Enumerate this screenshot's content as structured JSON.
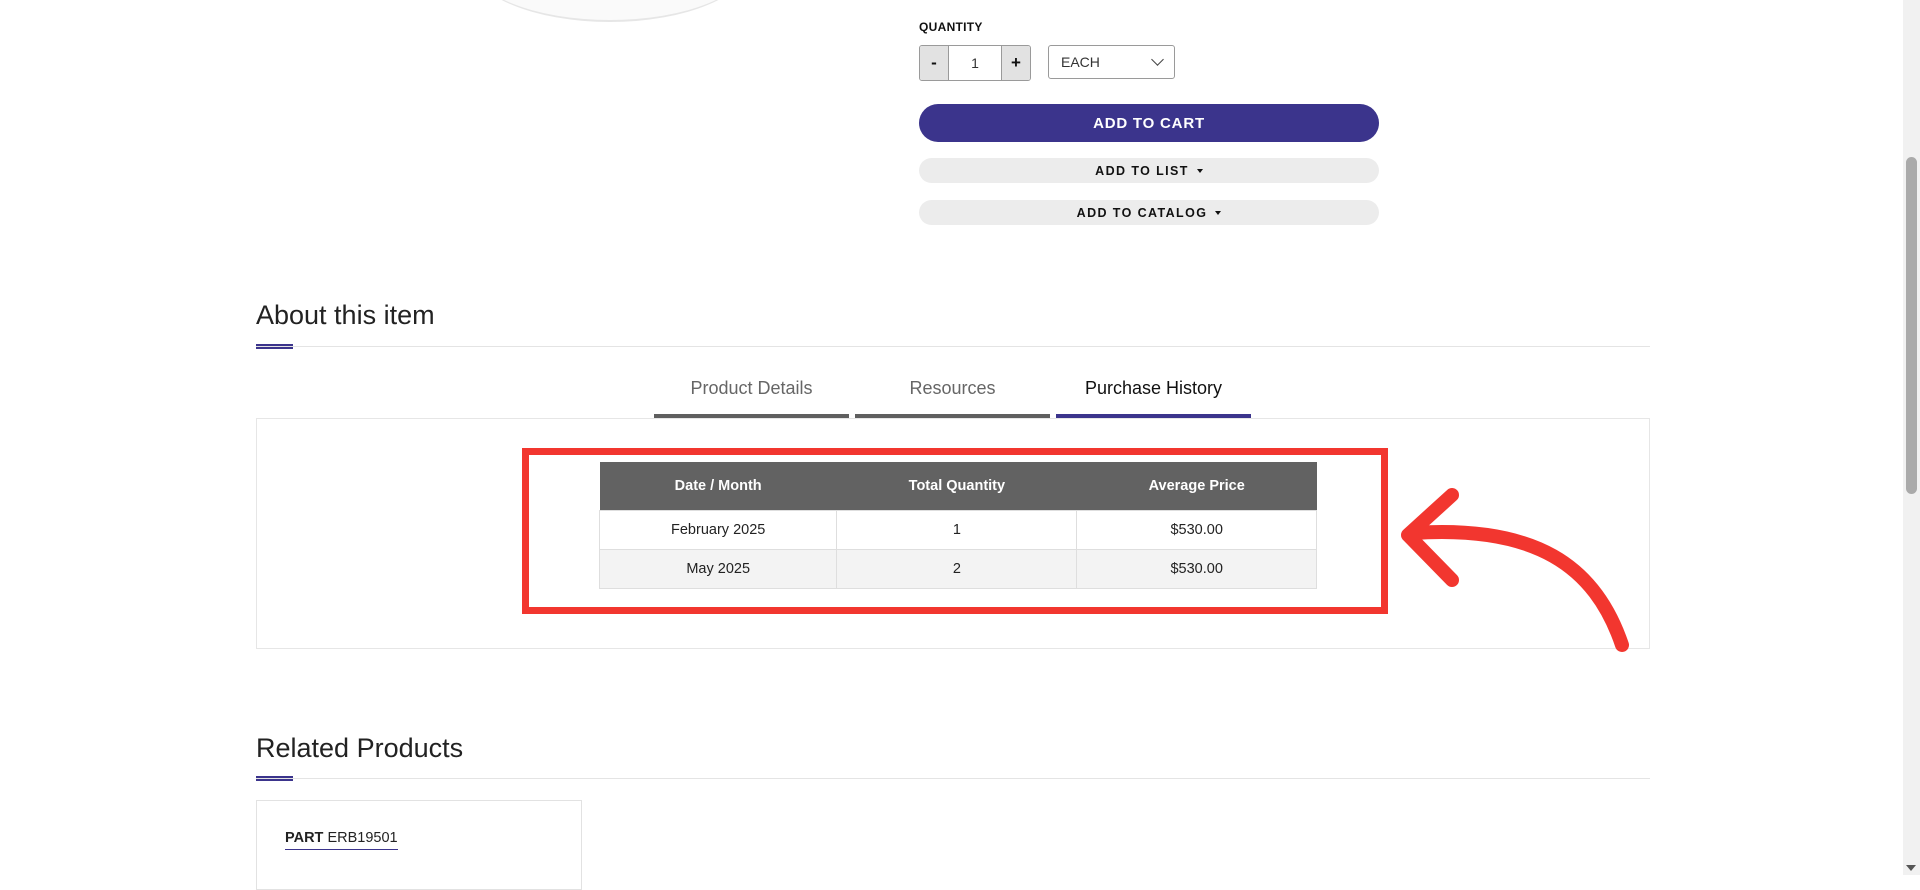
{
  "quantity": {
    "label": "QUANTITY",
    "decrement": "-",
    "value": "1",
    "increment": "+",
    "unit_selected": "EACH"
  },
  "actions": {
    "add_to_cart": "ADD TO CART",
    "add_to_list": "ADD TO LIST",
    "add_to_catalog": "ADD TO CATALOG"
  },
  "about": {
    "title": "About this item",
    "tabs": [
      {
        "label": "Product Details",
        "active": false
      },
      {
        "label": "Resources",
        "active": false
      },
      {
        "label": "Purchase History",
        "active": true
      }
    ],
    "purchase_history": {
      "columns": [
        "Date / Month",
        "Total Quantity",
        "Average Price"
      ],
      "rows": [
        {
          "date": "February 2025",
          "quantity": "1",
          "price": "$530.00"
        },
        {
          "date": "May 2025",
          "quantity": "2",
          "price": "$530.00"
        }
      ]
    }
  },
  "related": {
    "title": "Related Products",
    "items": [
      {
        "part_label": "PART",
        "part_number": "ERB19501"
      }
    ]
  },
  "annotation": {
    "color": "#f2362f"
  },
  "colors": {
    "accent": "#3b348c",
    "table_header": "#626262"
  }
}
